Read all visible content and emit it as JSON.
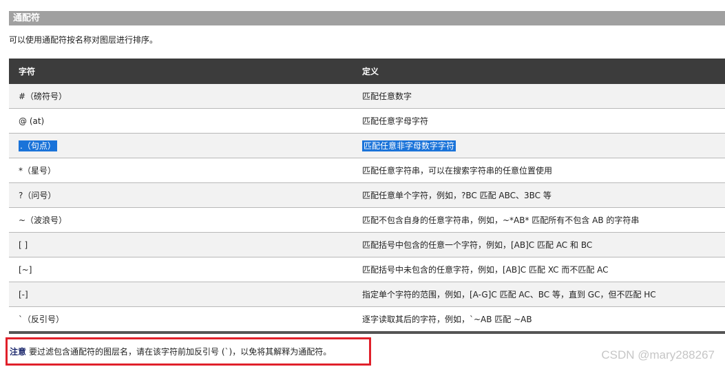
{
  "section": {
    "title": "通配符"
  },
  "intro": "可以使用通配符按名称对图层进行排序。",
  "table": {
    "headers": [
      "字符",
      "定义"
    ],
    "rows": [
      {
        "character": "#（磅符号）",
        "definition": "匹配任意数字"
      },
      {
        "character": "@ (at)",
        "definition": "匹配任意字母字符"
      },
      {
        "character": ".（句点）",
        "definition": "匹配任意非字母数字字符"
      },
      {
        "character": "*（星号）",
        "definition": "匹配任意字符串，可以在搜索字符串的任意位置使用"
      },
      {
        "character": "?（问号）",
        "definition": "匹配任意单个字符，例如，?BC 匹配 ABC、3BC 等"
      },
      {
        "character": "~（波浪号）",
        "definition": "匹配不包含自身的任意字符串，例如，~*AB* 匹配所有不包含 AB 的字符串"
      },
      {
        "character": "[ ]",
        "definition": "匹配括号中包含的任意一个字符，例如，[AB]C 匹配 AC 和 BC"
      },
      {
        "character": "[~]",
        "definition": "匹配括号中未包含的任意字符，例如，[AB]C 匹配 XC 而不匹配 AC"
      },
      {
        "character": "[-]",
        "definition": "指定单个字符的范围，例如，[A-G]C 匹配 AC、BC 等，直到 GC，但不匹配 HC"
      },
      {
        "character": "`（反引号）",
        "definition": "逐字读取其后的字符，例如，`~AB 匹配 ~AB"
      }
    ]
  },
  "note": {
    "label": "注意",
    "text": "要过滤包含通配符的图层名，请在该字符前加反引号 (`)，以免将其解释为通配符。"
  },
  "watermark": "CSDN @mary288267",
  "colors": {
    "selection": "#1a73d9",
    "note_border": "#e0202a",
    "header_bg": "#3c3c3c"
  }
}
